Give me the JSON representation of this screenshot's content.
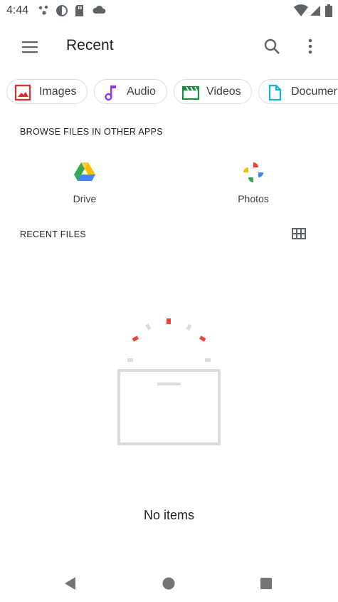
{
  "status_bar": {
    "time": "4:44"
  },
  "app_bar": {
    "title": "Recent"
  },
  "chips": [
    {
      "label": "Images",
      "icon": "image-icon",
      "color": "#d93025"
    },
    {
      "label": "Audio",
      "icon": "music-note-icon",
      "color": "#9334e6"
    },
    {
      "label": "Videos",
      "icon": "movie-icon",
      "color": "#1e8e3e"
    },
    {
      "label": "Documer",
      "icon": "document-icon",
      "color": "#12b5cb"
    }
  ],
  "browse_section": {
    "heading": "BROWSE FILES IN OTHER APPS",
    "apps": [
      {
        "label": "Drive",
        "icon": "google-drive-icon"
      },
      {
        "label": "Photos",
        "icon": "google-photos-icon"
      }
    ]
  },
  "recent_section": {
    "heading": "RECENT FILES",
    "view_toggle_icon": "grid-view-icon"
  },
  "empty_state": {
    "text": "No items",
    "accent": "#ea4335"
  },
  "nav_bar": {
    "icons": [
      "back-icon",
      "home-icon",
      "recents-icon"
    ]
  }
}
